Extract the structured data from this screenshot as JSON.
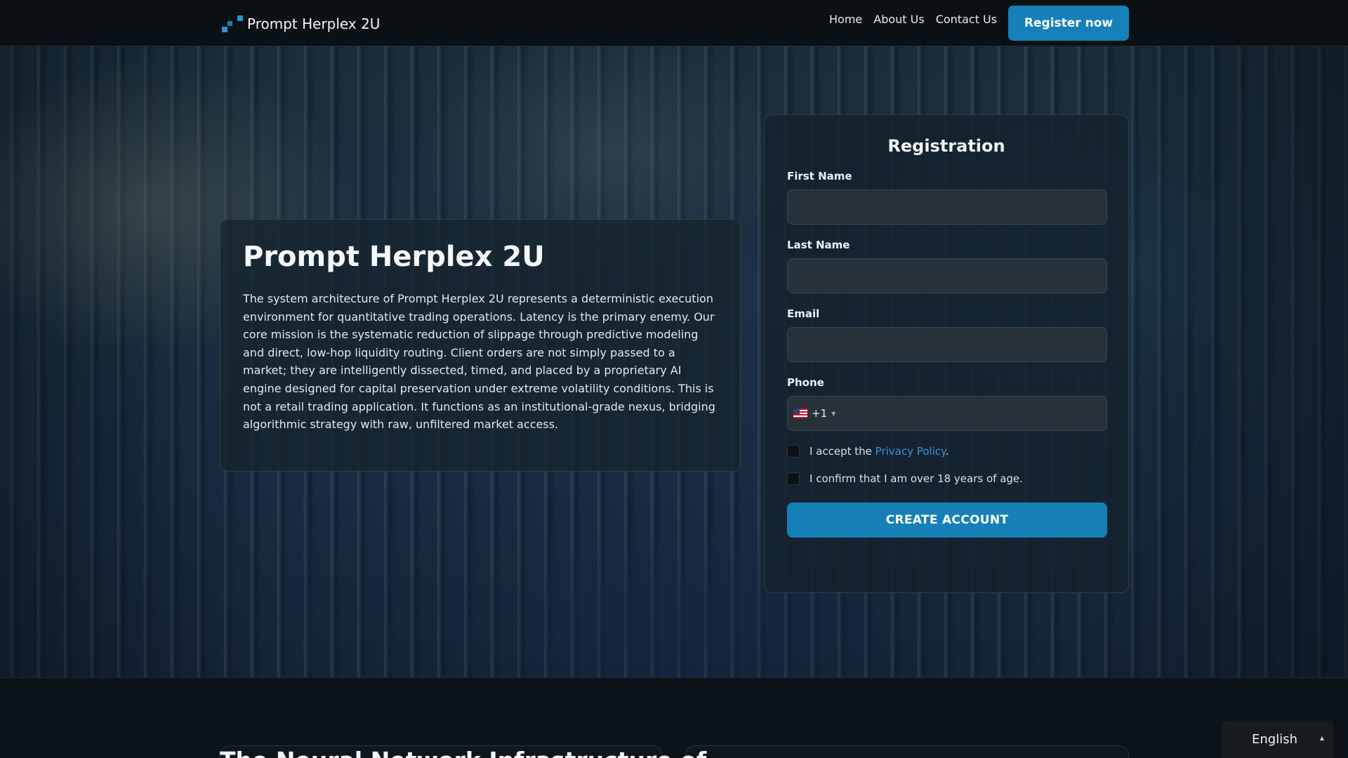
{
  "nav": {
    "brand": "Prompt Herplex 2U",
    "links": [
      "Home",
      "About Us",
      "Contact Us"
    ],
    "register_label": "Register now"
  },
  "intro": {
    "title": "Prompt Herplex 2U",
    "text": "The system architecture of Prompt Herplex 2U represents a deterministic execution environment for quantitative trading operations. Latency is the primary enemy. Our core mission is the systematic reduction of slippage through predictive modeling and direct, low-hop liquidity routing. Client orders are not simply passed to a market; they are intelligently dissected, timed, and placed by a proprietary AI engine designed for capital preservation under extreme volatility conditions. This is not a retail trading application. It functions as an institutional-grade nexus, bridging algorithmic strategy with raw, unfiltered market access."
  },
  "registration": {
    "title": "Registration",
    "fields": {
      "first_name": "First Name",
      "last_name": "Last Name",
      "email": "Email",
      "phone": "Phone"
    },
    "phone_code": "+1",
    "privacy_prefix": "I accept the ",
    "privacy_link": "Privacy Policy",
    "privacy_suffix": ".",
    "age_confirm": "I confirm that I am over 18 years of age.",
    "submit_label": "CREATE ACCOUNT"
  },
  "lower": {
    "heading": "The Neural Network Infrastructure of"
  },
  "language": {
    "selected": "English"
  },
  "colors": {
    "accent": "#1680b8",
    "link": "#3d8ee0",
    "background": "#0a1117"
  }
}
